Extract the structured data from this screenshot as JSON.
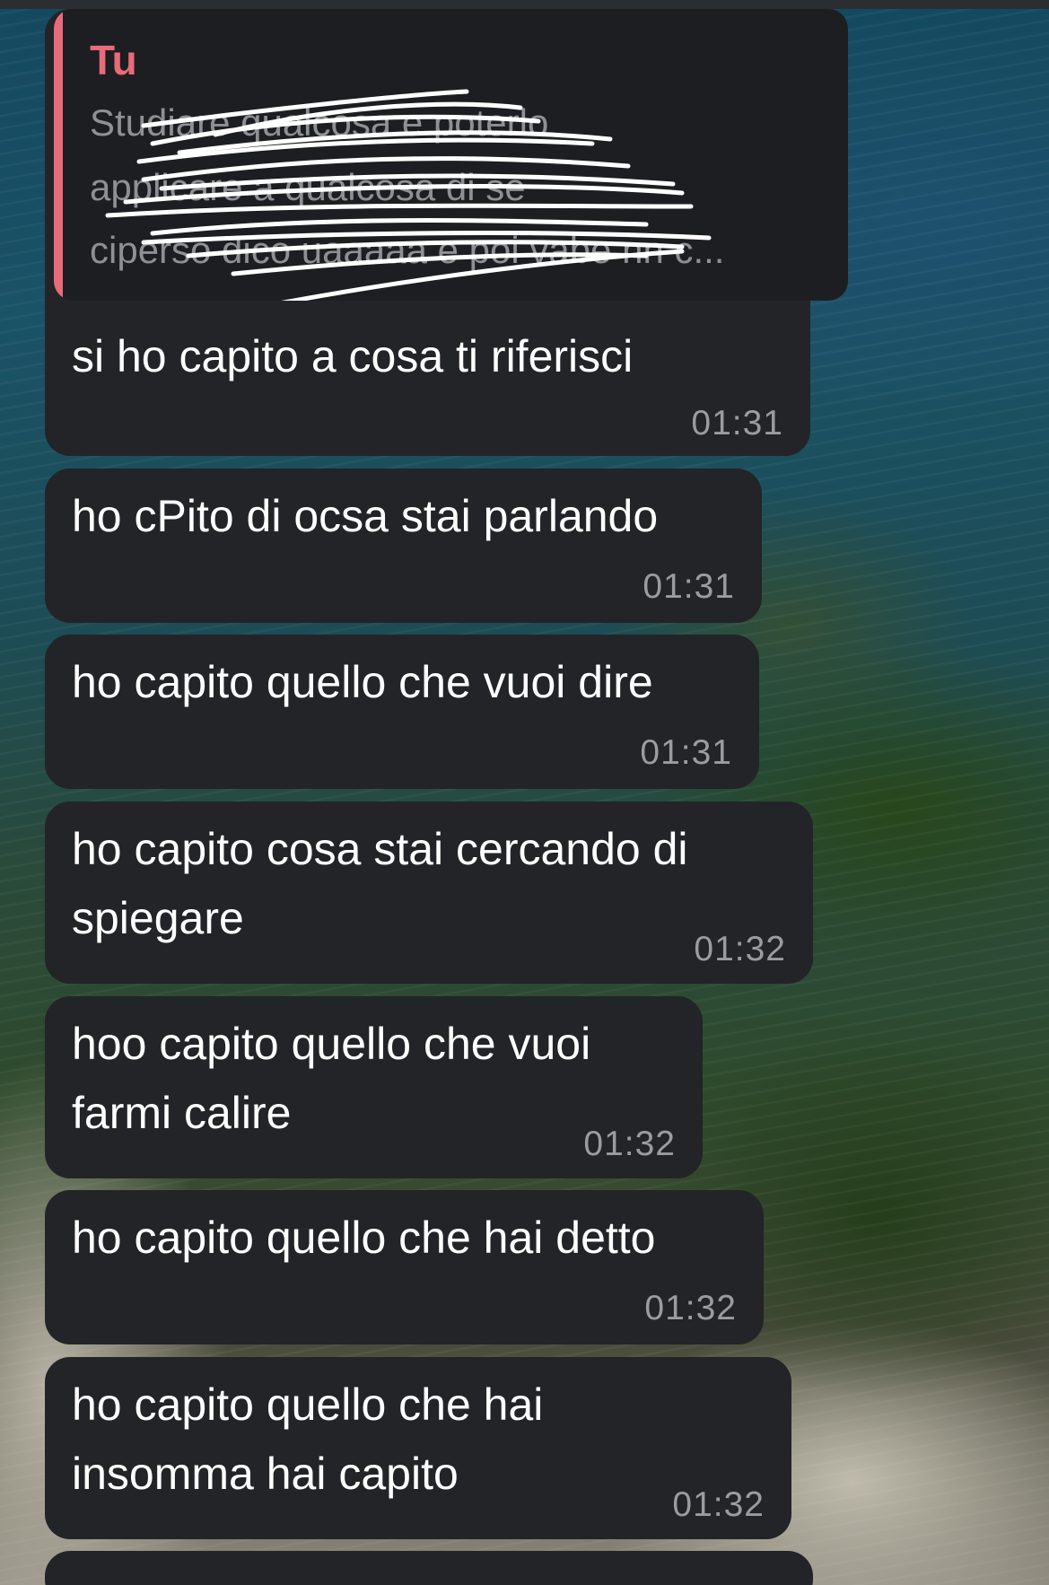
{
  "quote": {
    "author": "Tu",
    "lines": [
      "Studiare qualcosa e poterlo",
      "applicare a qualcosa di se",
      "ciperso dico uaaaaa e poi vabe nn c..."
    ]
  },
  "messages": [
    {
      "text_lines": [
        "si ho capito a cosa ti riferisci"
      ],
      "time": "01:31"
    },
    {
      "text_lines": [
        "ho cPito di ocsa stai parlando"
      ],
      "time": "01:31"
    },
    {
      "text_lines": [
        "ho capito quello che vuoi dire"
      ],
      "time": "01:31"
    },
    {
      "text_lines": [
        "ho capito cosa stai cercando di",
        "spiegare"
      ],
      "time": "01:32"
    },
    {
      "text_lines": [
        "hoo capito quello che vuoi",
        "farmi calire"
      ],
      "time": "01:32"
    },
    {
      "text_lines": [
        "ho capito quello che hai detto"
      ],
      "time": "01:32"
    },
    {
      "text_lines": [
        "ho capito quello che hai",
        "insomma hai capito"
      ],
      "time": "01:32"
    }
  ]
}
